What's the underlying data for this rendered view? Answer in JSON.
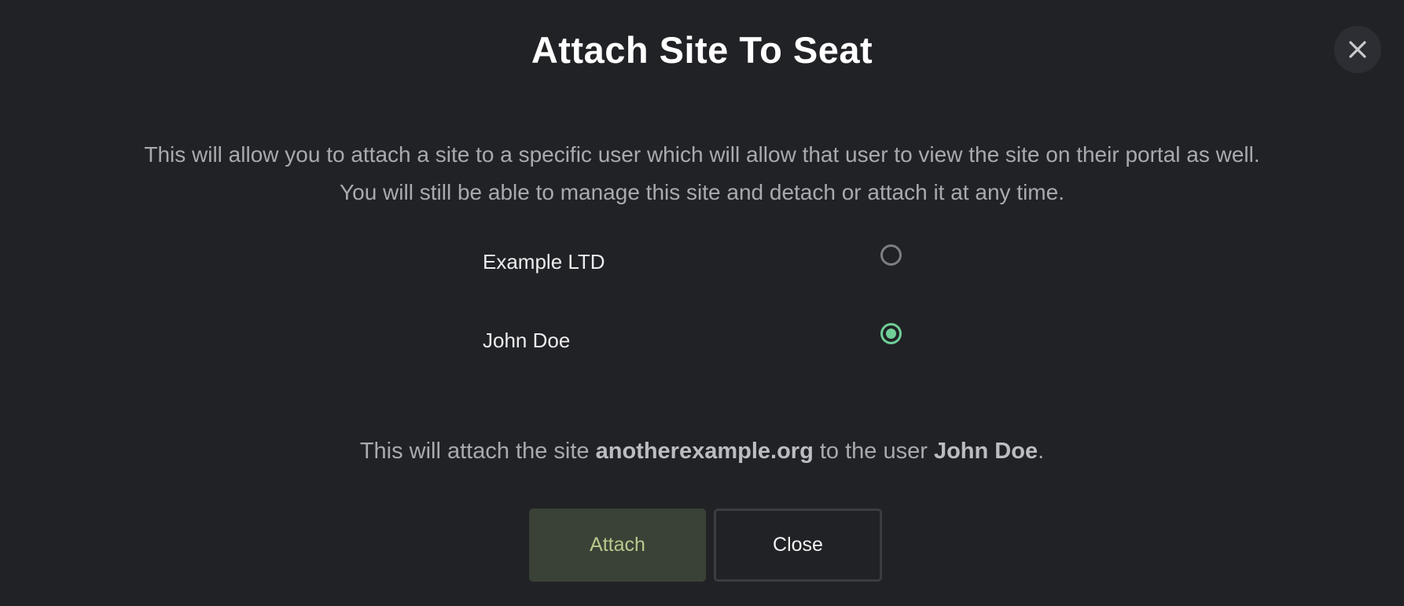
{
  "modal": {
    "title": "Attach Site To Seat",
    "close_icon": "close-icon",
    "description_line1": "This will allow you to attach a site to a specific user which will allow that user to view the site on their portal as well.",
    "description_line2": "You will still be able to manage this site and detach or attach it at any time."
  },
  "options": [
    {
      "label": "Example LTD",
      "selected": false
    },
    {
      "label": "John Doe",
      "selected": true
    }
  ],
  "summary": {
    "prefix": "This will attach the site ",
    "site": "anotherexample.org",
    "middle": " to the user ",
    "user": "John Doe",
    "suffix": "."
  },
  "buttons": {
    "attach_label": "Attach",
    "close_label": "Close"
  },
  "colors": {
    "background": "#212226",
    "accent": "#6fcf97",
    "attach_bg": "#3a4237",
    "attach_text": "#b6c98c"
  }
}
